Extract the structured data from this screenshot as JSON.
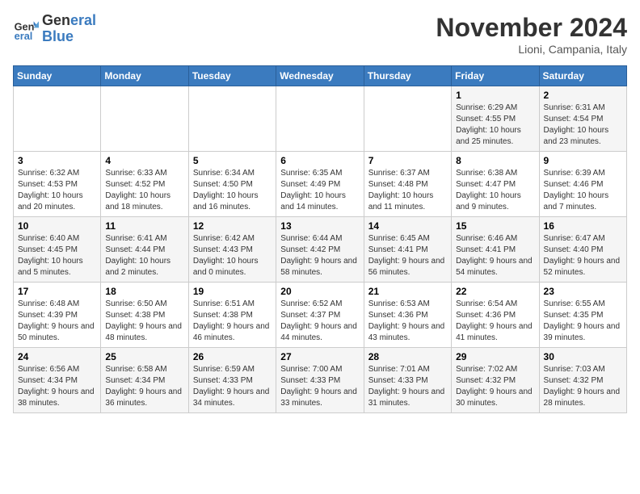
{
  "header": {
    "logo_line1": "General",
    "logo_line2": "Blue",
    "month": "November 2024",
    "location": "Lioni, Campania, Italy"
  },
  "days_of_week": [
    "Sunday",
    "Monday",
    "Tuesday",
    "Wednesday",
    "Thursday",
    "Friday",
    "Saturday"
  ],
  "weeks": [
    [
      {
        "day": "",
        "info": ""
      },
      {
        "day": "",
        "info": ""
      },
      {
        "day": "",
        "info": ""
      },
      {
        "day": "",
        "info": ""
      },
      {
        "day": "",
        "info": ""
      },
      {
        "day": "1",
        "info": "Sunrise: 6:29 AM\nSunset: 4:55 PM\nDaylight: 10 hours and 25 minutes."
      },
      {
        "day": "2",
        "info": "Sunrise: 6:31 AM\nSunset: 4:54 PM\nDaylight: 10 hours and 23 minutes."
      }
    ],
    [
      {
        "day": "3",
        "info": "Sunrise: 6:32 AM\nSunset: 4:53 PM\nDaylight: 10 hours and 20 minutes."
      },
      {
        "day": "4",
        "info": "Sunrise: 6:33 AM\nSunset: 4:52 PM\nDaylight: 10 hours and 18 minutes."
      },
      {
        "day": "5",
        "info": "Sunrise: 6:34 AM\nSunset: 4:50 PM\nDaylight: 10 hours and 16 minutes."
      },
      {
        "day": "6",
        "info": "Sunrise: 6:35 AM\nSunset: 4:49 PM\nDaylight: 10 hours and 14 minutes."
      },
      {
        "day": "7",
        "info": "Sunrise: 6:37 AM\nSunset: 4:48 PM\nDaylight: 10 hours and 11 minutes."
      },
      {
        "day": "8",
        "info": "Sunrise: 6:38 AM\nSunset: 4:47 PM\nDaylight: 10 hours and 9 minutes."
      },
      {
        "day": "9",
        "info": "Sunrise: 6:39 AM\nSunset: 4:46 PM\nDaylight: 10 hours and 7 minutes."
      }
    ],
    [
      {
        "day": "10",
        "info": "Sunrise: 6:40 AM\nSunset: 4:45 PM\nDaylight: 10 hours and 5 minutes."
      },
      {
        "day": "11",
        "info": "Sunrise: 6:41 AM\nSunset: 4:44 PM\nDaylight: 10 hours and 2 minutes."
      },
      {
        "day": "12",
        "info": "Sunrise: 6:42 AM\nSunset: 4:43 PM\nDaylight: 10 hours and 0 minutes."
      },
      {
        "day": "13",
        "info": "Sunrise: 6:44 AM\nSunset: 4:42 PM\nDaylight: 9 hours and 58 minutes."
      },
      {
        "day": "14",
        "info": "Sunrise: 6:45 AM\nSunset: 4:41 PM\nDaylight: 9 hours and 56 minutes."
      },
      {
        "day": "15",
        "info": "Sunrise: 6:46 AM\nSunset: 4:41 PM\nDaylight: 9 hours and 54 minutes."
      },
      {
        "day": "16",
        "info": "Sunrise: 6:47 AM\nSunset: 4:40 PM\nDaylight: 9 hours and 52 minutes."
      }
    ],
    [
      {
        "day": "17",
        "info": "Sunrise: 6:48 AM\nSunset: 4:39 PM\nDaylight: 9 hours and 50 minutes."
      },
      {
        "day": "18",
        "info": "Sunrise: 6:50 AM\nSunset: 4:38 PM\nDaylight: 9 hours and 48 minutes."
      },
      {
        "day": "19",
        "info": "Sunrise: 6:51 AM\nSunset: 4:38 PM\nDaylight: 9 hours and 46 minutes."
      },
      {
        "day": "20",
        "info": "Sunrise: 6:52 AM\nSunset: 4:37 PM\nDaylight: 9 hours and 44 minutes."
      },
      {
        "day": "21",
        "info": "Sunrise: 6:53 AM\nSunset: 4:36 PM\nDaylight: 9 hours and 43 minutes."
      },
      {
        "day": "22",
        "info": "Sunrise: 6:54 AM\nSunset: 4:36 PM\nDaylight: 9 hours and 41 minutes."
      },
      {
        "day": "23",
        "info": "Sunrise: 6:55 AM\nSunset: 4:35 PM\nDaylight: 9 hours and 39 minutes."
      }
    ],
    [
      {
        "day": "24",
        "info": "Sunrise: 6:56 AM\nSunset: 4:34 PM\nDaylight: 9 hours and 38 minutes."
      },
      {
        "day": "25",
        "info": "Sunrise: 6:58 AM\nSunset: 4:34 PM\nDaylight: 9 hours and 36 minutes."
      },
      {
        "day": "26",
        "info": "Sunrise: 6:59 AM\nSunset: 4:33 PM\nDaylight: 9 hours and 34 minutes."
      },
      {
        "day": "27",
        "info": "Sunrise: 7:00 AM\nSunset: 4:33 PM\nDaylight: 9 hours and 33 minutes."
      },
      {
        "day": "28",
        "info": "Sunrise: 7:01 AM\nSunset: 4:33 PM\nDaylight: 9 hours and 31 minutes."
      },
      {
        "day": "29",
        "info": "Sunrise: 7:02 AM\nSunset: 4:32 PM\nDaylight: 9 hours and 30 minutes."
      },
      {
        "day": "30",
        "info": "Sunrise: 7:03 AM\nSunset: 4:32 PM\nDaylight: 9 hours and 28 minutes."
      }
    ]
  ]
}
